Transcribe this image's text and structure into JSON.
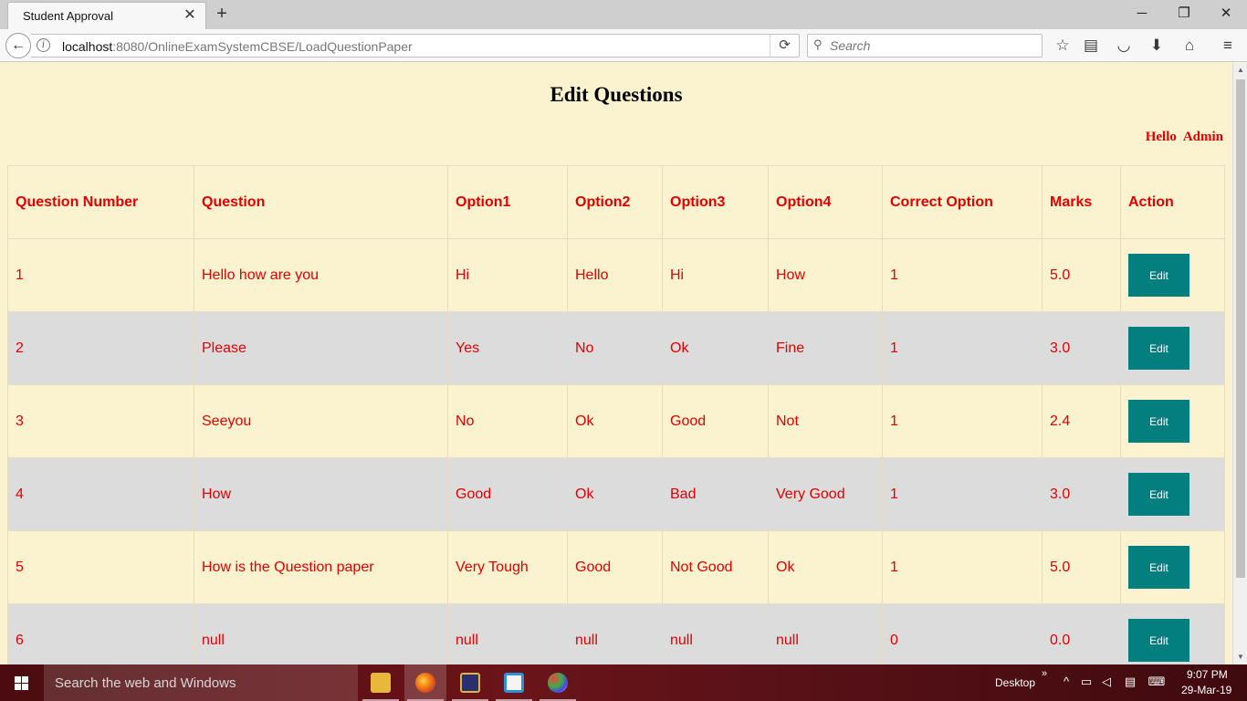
{
  "browser": {
    "tab_title": "Student Approval",
    "url_host": "localhost",
    "url_rest": ":8080/OnlineExamSystemCBSE/LoadQuestionPaper",
    "search_placeholder": "Search"
  },
  "page": {
    "title": "Edit Questions",
    "greeting": "Hello  Admin"
  },
  "table": {
    "headers": [
      "Question Number",
      "Question",
      "Option1",
      "Option2",
      "Option3",
      "Option4",
      "Correct Option",
      "Marks",
      "Action"
    ],
    "rows": [
      [
        "1",
        "Hello how are you",
        "Hi",
        "Hello",
        "Hi",
        "How",
        "1",
        "5.0"
      ],
      [
        "2",
        "Please",
        "Yes",
        "No",
        "Ok",
        "Fine",
        "1",
        "3.0"
      ],
      [
        "3",
        "Seeyou",
        "No",
        "Ok",
        "Good",
        "Not",
        "1",
        "2.4"
      ],
      [
        "4",
        "How",
        "Good",
        "Ok",
        "Bad",
        "Very Good",
        "1",
        "3.0"
      ],
      [
        "5",
        "How is the Question paper",
        "Very Tough",
        "Good",
        "Not Good",
        "Ok",
        "1",
        "5.0"
      ],
      [
        "6",
        "null",
        "null",
        "null",
        "null",
        "null",
        "0",
        "0.0"
      ]
    ],
    "edit_label": "Edit"
  },
  "taskbar": {
    "search_text": "Search the web and Windows",
    "desktop_label": "Desktop",
    "time": "9:07 PM",
    "date": "29-Mar-19"
  },
  "colors": {
    "page_bg": "#fbf3d0",
    "alt_row_bg": "#dcdcdc",
    "text_red": "#e00000",
    "button_teal": "#047f7f"
  }
}
